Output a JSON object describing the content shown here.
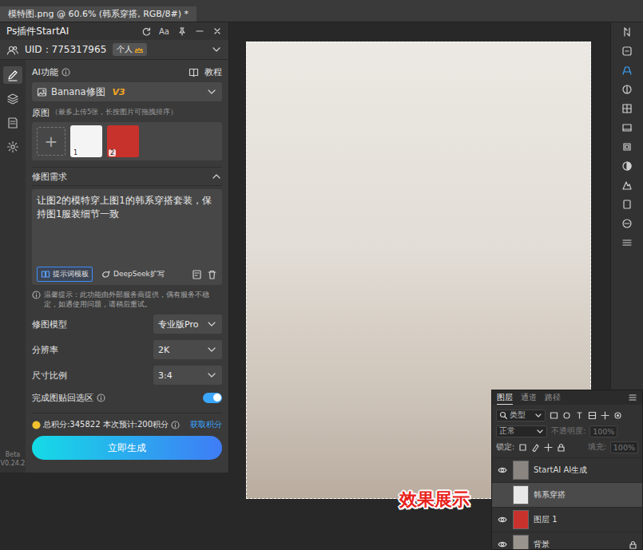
{
  "document_tab": {
    "title": "模特图.png @ 60.6% (韩系穿搭, RGB/8#) *",
    "selected": true
  },
  "plugin": {
    "title": "Ps插件StartAI",
    "text_buttons": [
      "Aa"
    ],
    "uid": "UID：775317965",
    "account_badge": "个人",
    "sidebar": {
      "items": [
        {
          "selected": true
        },
        {
          "selected": false
        },
        {
          "selected": false
        },
        {
          "selected": false
        }
      ],
      "beta": "Beta",
      "version": "V0.24.2"
    },
    "ai_function": {
      "label": "AI功能",
      "tutorial": "教程",
      "mode": "Banana修图",
      "mode_version": "V3"
    },
    "source_images": {
      "label": "原图",
      "hint": "（最多上传5张，长按图片可拖拽排序）",
      "add": "+",
      "images": [
        {
          "index": "1",
          "color": "#f4f4f4"
        },
        {
          "index": "2",
          "color": "#c8322c"
        }
      ]
    },
    "prompt": {
      "title": "修图需求",
      "expanded": true,
      "text": "让图2的模特穿上图1的韩系穿搭套装，保持图1服装细节一致",
      "buttons": [
        {
          "label": "提示词模板",
          "selected": true
        },
        {
          "label": "DeepSeek扩写",
          "selected": false
        }
      ],
      "notice": "温馨提示：此功能由外部服务商提供，偶有服务不稳定，如遇使用问题，请稍后重试。"
    },
    "settings": [
      {
        "kind": "select",
        "label": "修图模型",
        "value": "专业版Pro"
      },
      {
        "kind": "select",
        "label": "分辨率",
        "value": "2K"
      },
      {
        "kind": "select",
        "label": "尺寸比例",
        "value": "3:4"
      },
      {
        "kind": "toggle",
        "label": "完成图贴回选区",
        "on": true
      }
    ],
    "footer": {
      "points": "总积分:345822",
      "estimate": "本次预计:200积分",
      "get_points": "获取积分",
      "generate": "立即生成"
    }
  },
  "layers_panel": {
    "tabs": [
      {
        "label": "图层",
        "selected": true
      },
      {
        "label": "通道",
        "selected": false
      },
      {
        "label": "路径",
        "selected": false
      }
    ],
    "filter": "类型",
    "blend_mode": "正常",
    "opacity_label": "不透明度:",
    "opacity": "100%",
    "lock_label": "锁定:",
    "fill_label": "填充:",
    "fill": "100%",
    "layers": [
      {
        "name": "StartAI AI生成",
        "visible": true,
        "selected": false,
        "locked": false,
        "color": "#8a8580"
      },
      {
        "name": "韩系穿搭",
        "visible": false,
        "selected": true,
        "locked": false,
        "color": "#e8e8e8"
      },
      {
        "name": "图层 1",
        "visible": true,
        "selected": false,
        "locked": false,
        "color": "#c8322c"
      },
      {
        "name": "背景",
        "visible": true,
        "selected": false,
        "locked": true,
        "color": "#9a948e"
      }
    ]
  },
  "canvas": {
    "caption": "效果展示"
  }
}
